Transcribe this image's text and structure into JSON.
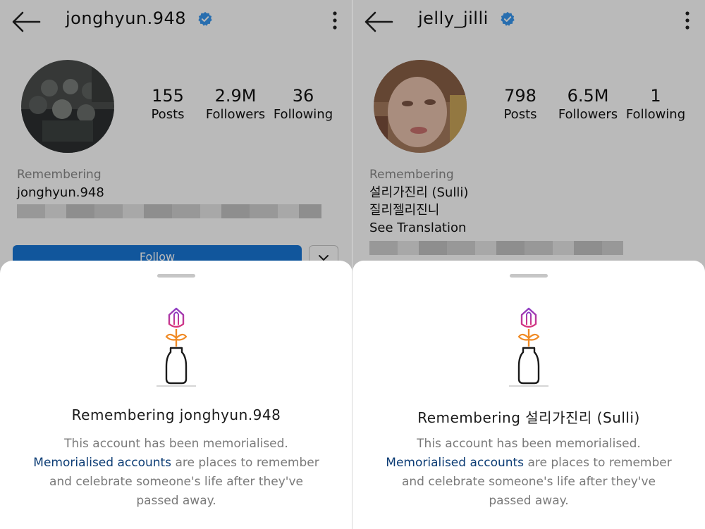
{
  "left": {
    "username": "jonghyun.948",
    "stats": [
      {
        "value": "155",
        "label": "Posts"
      },
      {
        "value": "2.9M",
        "label": "Followers"
      },
      {
        "value": "36",
        "label": "Following"
      }
    ],
    "bio": {
      "remembering": "Remembering",
      "lines": [
        "jonghyun.948"
      ]
    },
    "follow_button": "Follow",
    "sheet": {
      "title": "Remembering jonghyun.948",
      "line1": "This account has been memorialised.",
      "link": "Memorialised accounts",
      "line2_rest": " are places to remember",
      "line3": "and celebrate someone's life after they've",
      "line4": "passed away."
    }
  },
  "right": {
    "username": "jelly_jilli",
    "stats": [
      {
        "value": "798",
        "label": "Posts"
      },
      {
        "value": "6.5M",
        "label": "Followers"
      },
      {
        "value": "1",
        "label": "Following"
      }
    ],
    "bio": {
      "remembering": "Remembering",
      "lines": [
        "설리가진리 (Sulli)",
        "질리젤리진니"
      ],
      "see_translation": "See Translation"
    },
    "sheet": {
      "title": "Remembering 설리가진리 (Sulli)",
      "line1": "This account has been memorialised.",
      "link": "Memorialised accounts",
      "line2_rest": " are places to remember",
      "line3": "and celebrate someone's life after they've",
      "line4": "passed away."
    }
  },
  "icons": {
    "back": "back-arrow-icon",
    "verified": "verified-badge-icon",
    "more": "more-options-icon",
    "flower": "memorial-flower-vase-icon",
    "chevron": "chevron-down-icon"
  },
  "colors": {
    "follow_blue": "#1877d6",
    "verified_blue": "#3897f0",
    "link_navy": "#0d3d75",
    "flower_purple": "#9b3fb5",
    "flower_orange": "#f08a24"
  }
}
